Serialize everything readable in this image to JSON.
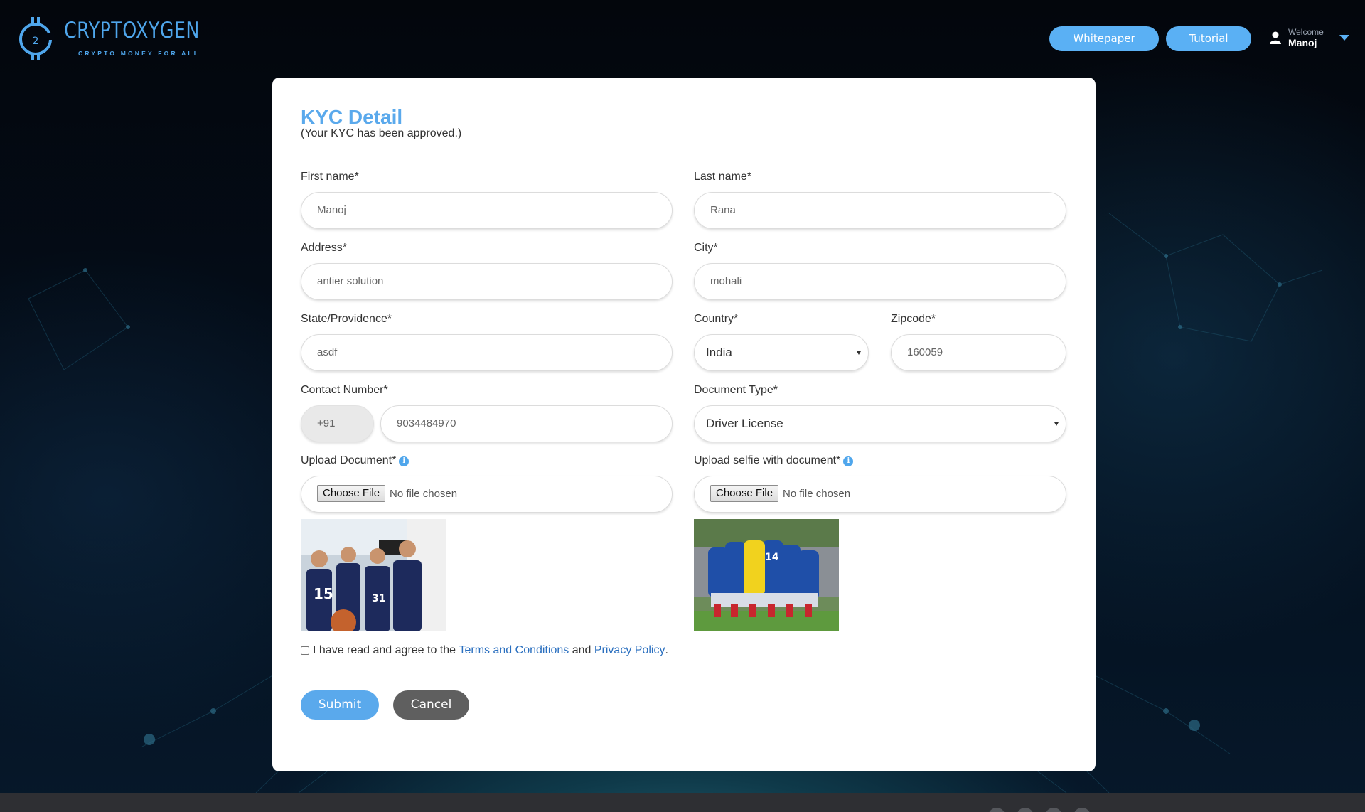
{
  "header": {
    "logo_title": "CRYPTOXYGEN",
    "logo_tagline": "CRYPTO MONEY FOR ALL",
    "whitepaper_label": "Whitepaper",
    "tutorial_label": "Tutorial",
    "welcome_label": "Welcome",
    "user_name": "Manoj",
    "accent_color": "#5ab0f4"
  },
  "form": {
    "title": "KYC Detail",
    "status": "(Your KYC has been approved.)",
    "fields": {
      "first_name": {
        "label": "First name*",
        "value": "Manoj"
      },
      "last_name": {
        "label": "Last name*",
        "value": "Rana"
      },
      "address": {
        "label": "Address*",
        "value": "antier solution"
      },
      "city": {
        "label": "City*",
        "value": "mohali"
      },
      "state": {
        "label": "State/Providence*",
        "value": "asdf"
      },
      "country": {
        "label": "Country*",
        "value": "India"
      },
      "zipcode": {
        "label": "Zipcode*",
        "value": "160059"
      },
      "contact": {
        "label": "Contact Number*",
        "prefix": "+91",
        "value": "9034484970"
      },
      "document_type": {
        "label": "Document Type*",
        "value": "Driver License"
      },
      "upload_document": {
        "label": "Upload Document*",
        "button": "Choose File",
        "status": "No file chosen"
      },
      "upload_selfie": {
        "label": "Upload selfie with document*",
        "button": "Choose File",
        "status": "No file chosen"
      }
    },
    "terms": {
      "prefix": "I have read and agree to the",
      "terms_link": "Terms and Conditions",
      "and": "and",
      "privacy_link": "Privacy Policy",
      "suffix": "."
    },
    "submit_label": "Submit",
    "cancel_label": "Cancel"
  }
}
